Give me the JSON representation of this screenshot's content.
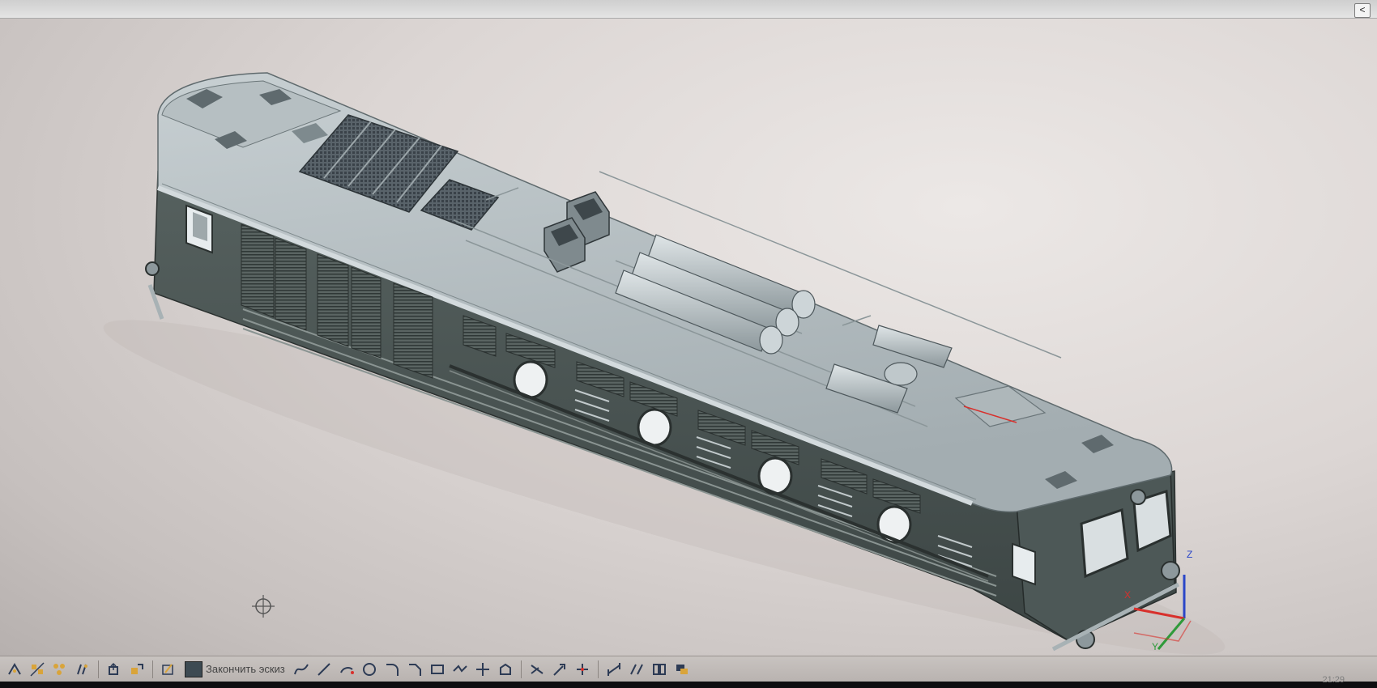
{
  "window": {
    "collapse_glyph": "<"
  },
  "toolbar": {
    "finish_sketch_label": "Закончить эскиз",
    "icons": [
      "trim-icon",
      "mirror-icon",
      "pattern-icon",
      "offset-icon",
      "project-icon",
      "constraint-icon",
      "sketch-icon"
    ],
    "sketch_tools": [
      "spline-icon",
      "line-icon",
      "arc-icon",
      "circle-icon",
      "fillet-icon",
      "chamfer-icon",
      "rectangle-icon",
      "polygon-line-icon",
      "point-icon",
      "shape-icon",
      "trim-line-icon",
      "extend-icon",
      "split-icon",
      "dimension-icon",
      "align-icon",
      "constraint-select-icon",
      "display-icon"
    ]
  },
  "axes": {
    "z": "Z",
    "x": "X",
    "y": "Y"
  },
  "taskbar": {
    "time": "21:29"
  },
  "colors": {
    "model_top": "#b3bcbf",
    "model_side": "#4a5457",
    "background": "#e4dfdd",
    "axis_x": "#d8302c",
    "axis_y": "#2f9a3a",
    "axis_z": "#2a46c8"
  }
}
